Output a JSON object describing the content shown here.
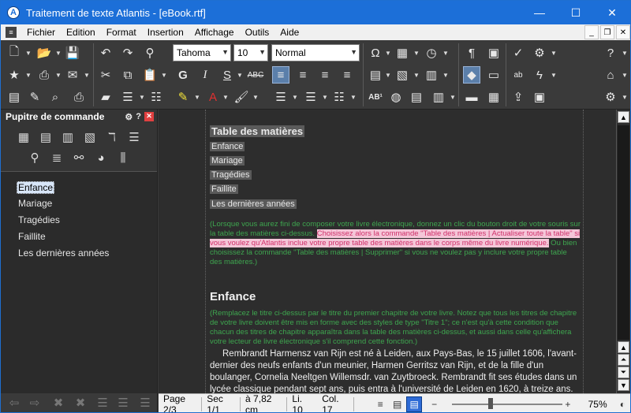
{
  "window": {
    "title": "Traitement de texte Atlantis - [eBook.rtf]",
    "app_icon": "A",
    "minimize": "—",
    "maximize": "☐",
    "close": "✕"
  },
  "menu": [
    "Fichier",
    "Edition",
    "Format",
    "Insertion",
    "Affichage",
    "Outils",
    "Aide"
  ],
  "toolbar": {
    "font_name": "Tahoma",
    "font_size": "10",
    "style_name": "Normal"
  },
  "panel": {
    "title": "Pupitre de commande",
    "items": [
      {
        "label": "Enfance",
        "selected": true
      },
      {
        "label": "Mariage",
        "selected": false
      },
      {
        "label": "Tragédies",
        "selected": false
      },
      {
        "label": "Faillite",
        "selected": false
      },
      {
        "label": "Les dernières années",
        "selected": false
      }
    ]
  },
  "document": {
    "toc_heading": "Table des matières",
    "toc_items": [
      "Enfance",
      "Mariage",
      "Tragédies",
      "Faillite",
      "Les dernières années"
    ],
    "note1_before": "(Lorsque vous aurez fini de composer votre livre électronique, donnez un clic du bouton droit de votre souris sur la table des matières ci-dessus. ",
    "note1_highlight": "Choisissez alors la commande \"Table des matières | Actualiser toute la table\" si vous voulez qu'Atlantis inclue votre propre table des matières dans le corps même du livre numérique.",
    "note1_after": " Ou bien choisissez la commande \"Table des matières | Supprimer\" si vous ne voulez pas y inclure votre propre table des matières.)",
    "chapter_heading": "Enfance",
    "note2": "(Remplacez le titre ci-dessus par le titre du premier chapitre de votre livre. Notez que tous les titres de chapitre de votre livre doivent être mis en forme avec des styles de type \"Titre 1\"; ce n'est qu'à cette condition que chacun des titres de chapitre apparaîtra dans la table des matières ci-dessus, et aussi dans celle qu'affichera votre lecteur de livre électronique s'il comprend cette fonction.)",
    "body": "Rembrandt Harmensz van Rijn est né à Leiden, aux Pays-Bas, le 15 juillet 1606, l'avant-dernier des neufs enfants d'un meunier, Harmen Gerritsz van Rijn, et de la fille d'un boulanger, Cornelia Neeltgen Willemsdr. van Zuytbroeck. Rembrandt fit ses études dans un lycée classique pendant sept ans, puis entra à l'université de Leiden en 1620, à treize ans. Quelques mois plus"
  },
  "status": {
    "page": "Page 2/3",
    "section": "Sec 1/1",
    "position": "à 7,82 cm",
    "line": "Li. 10",
    "column": "Col. 17",
    "zoom_minus": "−",
    "zoom_plus": "+",
    "zoom": "75%",
    "zoom_level": 0.35
  },
  "colors": {
    "titlebar": "#1c6fd8",
    "note_green": "#3ea64f",
    "highlight_pink": "#f4c6d8"
  }
}
